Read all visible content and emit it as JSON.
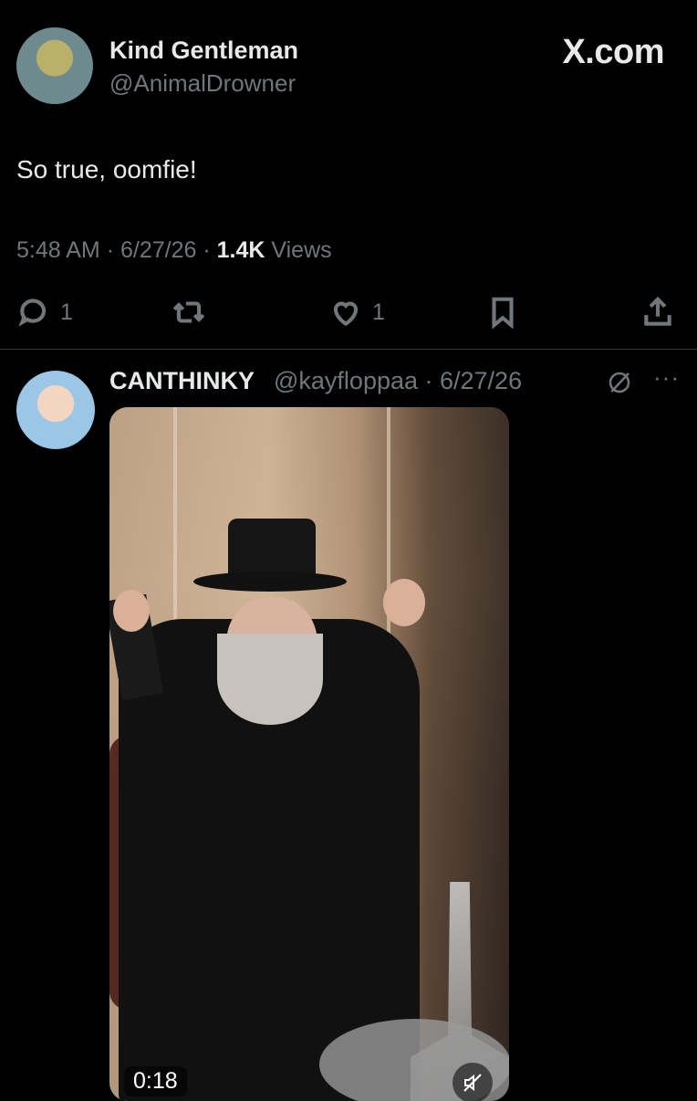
{
  "tweet": {
    "author_name": "Kind Gentleman",
    "author_handle": "@AnimalDrowner",
    "brand": "X.com",
    "text": "So true, oomfie!",
    "time": "5:48 AM",
    "sep1": "·",
    "date": "6/27/26",
    "sep2": "·",
    "views_count": "1.4K",
    "views_label": "Views",
    "actions": {
      "reply_count": "1",
      "like_count": "1"
    }
  },
  "quoted": {
    "author_name": "CANTHINKY",
    "author_handle": "@kayfloppaa · 6/27/26",
    "more": "···",
    "video": {
      "duration": "0:18"
    }
  },
  "icons": {
    "reply": "reply-icon",
    "retweet": "retweet-icon",
    "like": "heart-icon",
    "bookmark": "bookmark-icon",
    "share": "share-icon",
    "grok": "grok-icon",
    "mute": "mute-icon"
  },
  "colors": {
    "background": "#000000",
    "text_primary": "#e7e9ea",
    "text_secondary": "#71767b",
    "divider": "#2f3336"
  }
}
